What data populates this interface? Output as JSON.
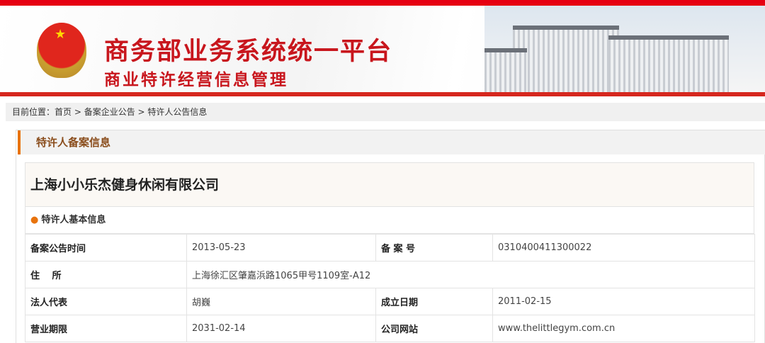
{
  "header": {
    "title": "商务部业务系统统一平台",
    "subtitle": "商业特许经营信息管理",
    "emblem": "national-emblem"
  },
  "breadcrumb": {
    "label": "目前位置：",
    "home": "首页",
    "sep": " > ",
    "level2": "备案企业公告",
    "current": "特许人公告信息"
  },
  "panel": {
    "title": "特许人备案信息",
    "company": "上海小小乐杰健身休闲有限公司",
    "section": "特许人基本信息"
  },
  "rows": [
    {
      "k1": "备案公告时间",
      "v1": "2013-05-23",
      "k2": "备 案 号",
      "v2": "0310400411300022"
    },
    {
      "k1": "住　 所",
      "v1": "上海徐汇区肇嘉浜路1065甲号1109室-A12"
    },
    {
      "k1": "法人代表",
      "v1": "胡巍",
      "k2": "成立日期",
      "v2": "2011-02-15"
    },
    {
      "k1": "营业期限",
      "v1": "2031-02-14",
      "k2": "公司网站",
      "v2": "www.thelittlegym.com.cn"
    }
  ],
  "colors": {
    "accent": "#e8730d",
    "brand": "#c8161d"
  }
}
